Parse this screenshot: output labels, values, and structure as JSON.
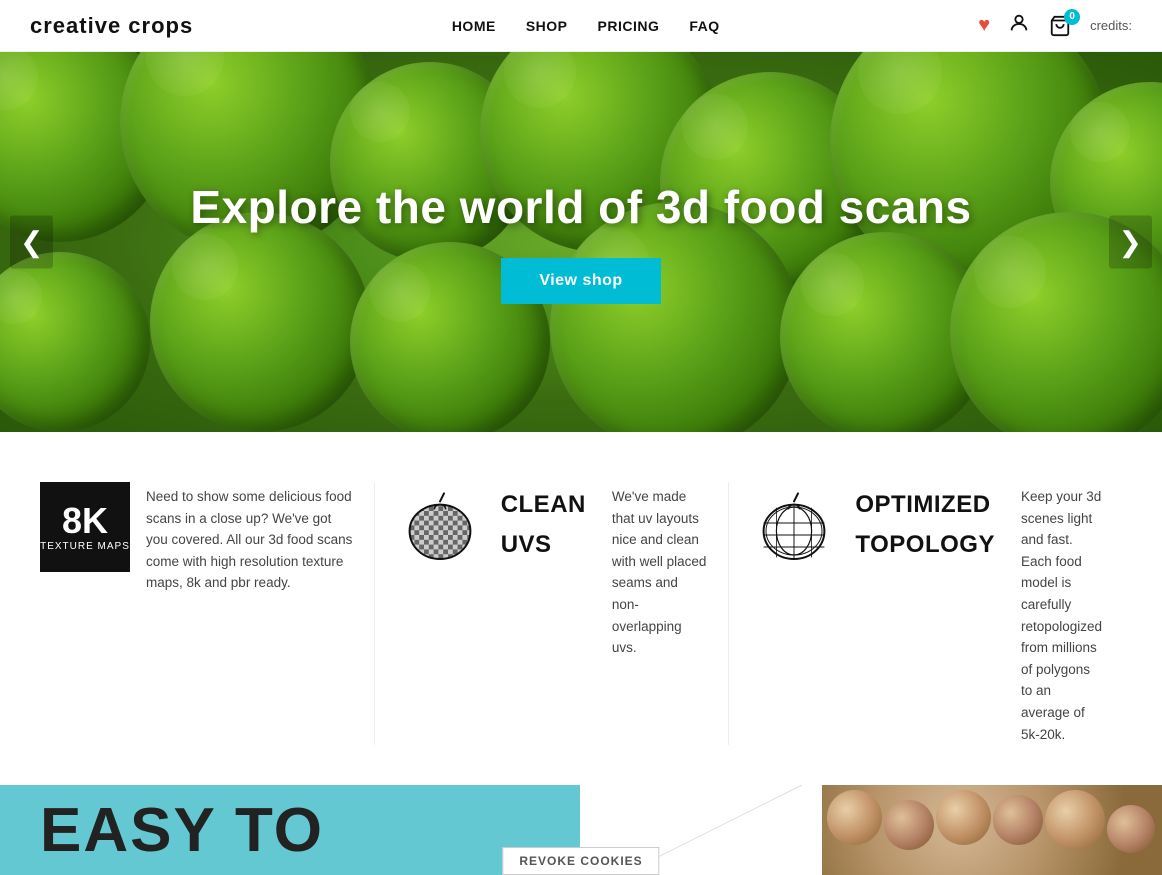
{
  "header": {
    "logo_regular": "creative ",
    "logo_bold": "crops",
    "nav": [
      {
        "label": "HOME",
        "href": "#"
      },
      {
        "label": "SHOP",
        "href": "#"
      },
      {
        "label": "PRICING",
        "href": "#"
      },
      {
        "label": "FAQ",
        "href": "#"
      }
    ],
    "wishlist_icon": "♥",
    "account_icon": "👤",
    "cart_icon": "🛒",
    "cart_count": "0",
    "credits_label": "credits:"
  },
  "hero": {
    "title": "Explore the world of 3d food scans",
    "cta_label": "View shop",
    "arrow_left": "❮",
    "arrow_right": "❯"
  },
  "features": [
    {
      "id": "8k",
      "icon_line1": "8K",
      "icon_line2": "TEXTURE MAPS",
      "text": "Need to show some delicious food scans in a close up? We've got you covered. All our 3d food scans come with high resolution texture maps, 8k and pbr ready."
    },
    {
      "id": "clean-uvs",
      "label_line1": "CLEAN",
      "label_line2": "UVS",
      "text": "We've made that uv layouts nice and clean with  well placed seams and non-overlapping uvs."
    },
    {
      "id": "optimized-topology",
      "label_line1": "OPTIMIZED",
      "label_line2": "TOPOLOGY",
      "text": "Keep your 3d scenes light and fast. Each food model is carefully retopologized from millions of polygons to an average of 5k-20k."
    }
  ],
  "bottom": {
    "easy_to_text": "EASY TO",
    "revoke_label": "REVOKE COOKIES"
  }
}
